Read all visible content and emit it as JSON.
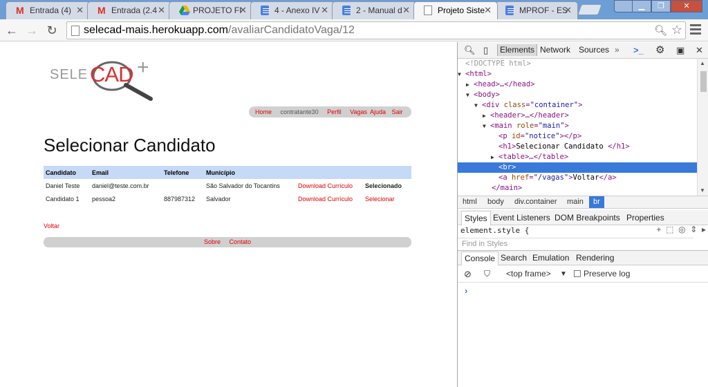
{
  "browser": {
    "tabs": [
      {
        "title": "Entrada (4)",
        "icon": "gmail-icon",
        "active": false
      },
      {
        "title": "Entrada (2.4",
        "icon": "gmail-icon",
        "active": false
      },
      {
        "title": "PROJETO FIN",
        "icon": "drive-icon",
        "active": false
      },
      {
        "title": "4 - Anexo IV",
        "icon": "docs-icon",
        "active": false
      },
      {
        "title": "2 - Manual d",
        "icon": "docs-icon",
        "active": false
      },
      {
        "title": "Projeto Siste",
        "icon": "page-icon",
        "active": true
      },
      {
        "title": "MPROF - ES",
        "icon": "docs-icon",
        "active": false
      }
    ],
    "url_host": "selecad-mais.herokuapp.com",
    "url_path": "/avaliarCandidatoVaga/12"
  },
  "site": {
    "logo": {
      "left": "SELE",
      "mid": "CAD",
      "plus": "+"
    },
    "nav": {
      "home": "Home",
      "user": "contratante30",
      "perfil": "Perfil",
      "vagas": "Vagas",
      "ajuda": "Ajuda",
      "sair": "Sair"
    },
    "title": "Selecionar Candidato",
    "table": {
      "headers": [
        "Candidato",
        "Email",
        "Telefone",
        "Município",
        "",
        ""
      ],
      "rows": [
        [
          "Daniel Teste",
          "daniel@teste.com.br",
          "",
          "São Salvador do Tocantins",
          "Download Currículo",
          "Selecionado"
        ],
        [
          "Candidato 1",
          "pessoa2",
          "887987312",
          "Salvador",
          "Download Currículo",
          "Selecionar"
        ]
      ]
    },
    "back_link": "Voltar",
    "footer": {
      "sobre": "Sobre",
      "contato": "Contato"
    }
  },
  "devtools": {
    "tabs": [
      "Elements",
      "Network",
      "Sources",
      "»"
    ],
    "dom": [
      {
        "text": "<!DOCTYPE html>",
        "kind": "comment"
      },
      {
        "tag": "html"
      },
      {
        "tag": "head",
        "rest": "…</head>"
      },
      {
        "tag": "body"
      },
      {
        "tag": "div",
        "attr": "class",
        "val": "\"container\""
      },
      {
        "tag": "header",
        "rest": "…</header>"
      },
      {
        "tag": "main",
        "attr": "role",
        "val": "\"main\""
      },
      {
        "tag": "p",
        "attr": "id",
        "val": "\"notice\"",
        "rest": "</p>"
      },
      {
        "tag": "h1",
        "inner": "Selecionar Candidato ",
        "rest": "</h1>"
      },
      {
        "tag": "table",
        "rest": "…</table>"
      },
      {
        "tag": "br"
      },
      {
        "tag": "a",
        "attr": "href",
        "val": "\"/vagas\"",
        "inner": "Voltar",
        "rest": "</a>"
      },
      {
        "text": "</main>",
        "kind": "close"
      }
    ],
    "breadcrumbs": [
      "html",
      "body",
      "div.container",
      "main",
      "br"
    ],
    "subtabs": [
      "Styles",
      "Event Listeners",
      "DOM Breakpoints",
      "Properties"
    ],
    "element_style": "element.style {",
    "find_placeholder": "Find in Styles",
    "drawer_tabs": [
      "Console",
      "Search",
      "Emulation",
      "Rendering"
    ],
    "console_frame": "<top frame>",
    "preserve_log": "Preserve log",
    "prompt": "›"
  }
}
